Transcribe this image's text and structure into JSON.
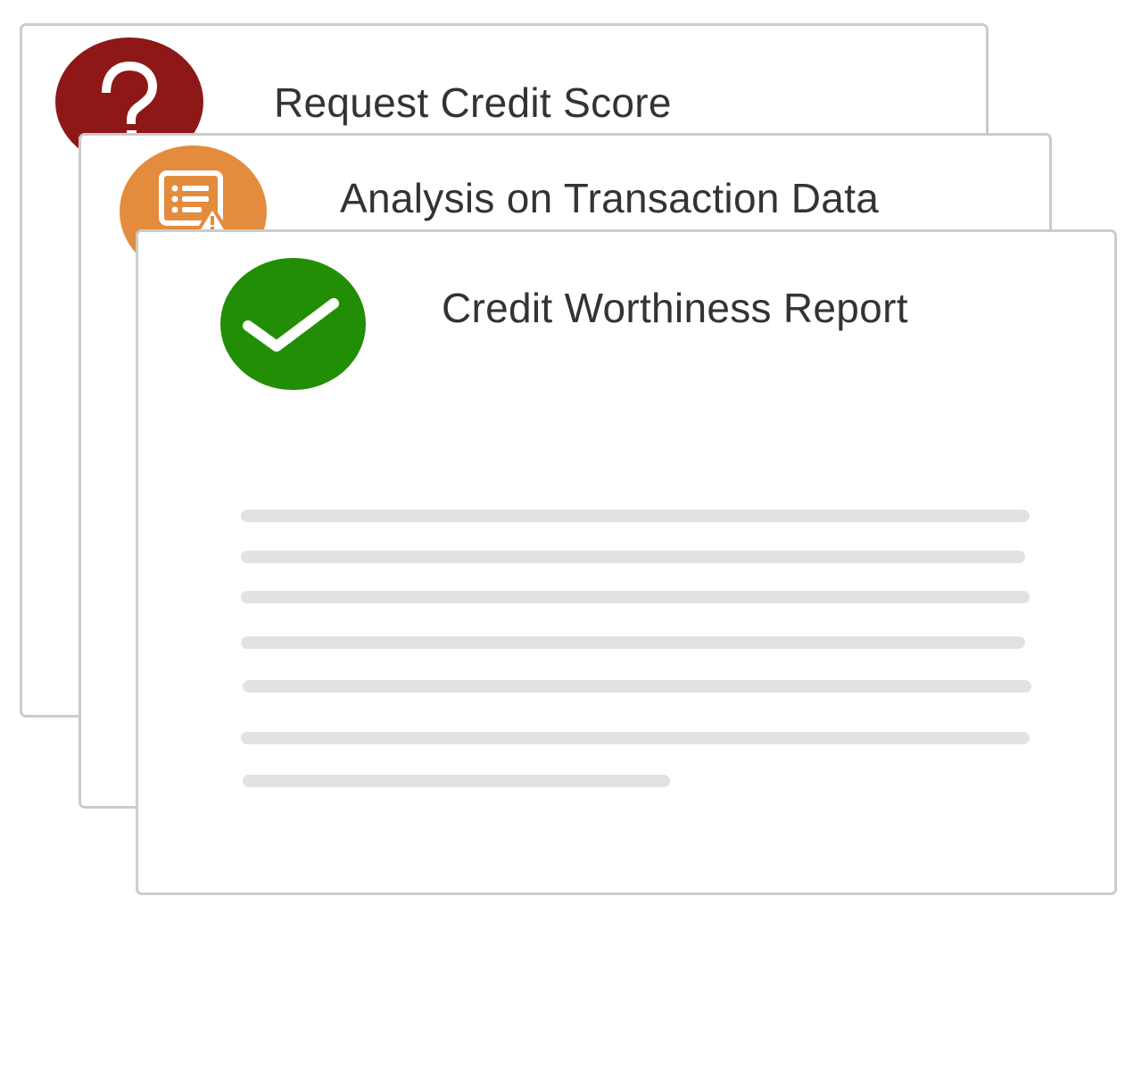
{
  "cards": [
    {
      "title": "Request Credit Score",
      "icon": "question-mark-icon",
      "icon_color": "#8e1818"
    },
    {
      "title": "Analysis on Transaction Data",
      "icon": "document-warning-icon",
      "icon_color": "#e38c3e"
    },
    {
      "title": "Credit Worthiness Report",
      "icon": "checkmark-icon",
      "icon_color": "#228e06"
    }
  ],
  "colors": {
    "card_border": "#cccccc",
    "title_text": "#333333",
    "placeholder_line": "#e2e2e2",
    "icon_glyph": "#ffffff"
  }
}
